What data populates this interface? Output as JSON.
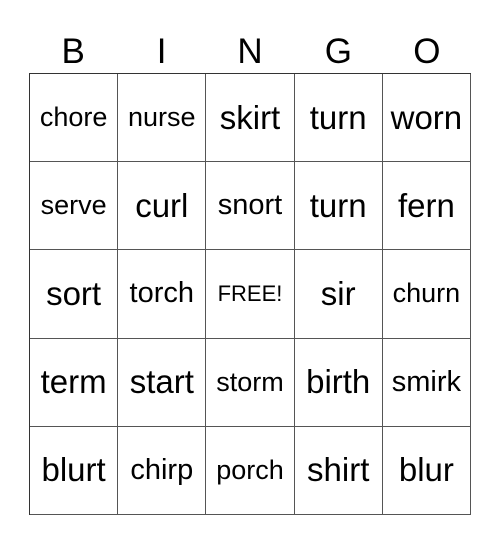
{
  "header": [
    "B",
    "I",
    "N",
    "G",
    "O"
  ],
  "cells": [
    [
      "chore",
      "nurse",
      "skirt",
      "turn",
      "worn"
    ],
    [
      "serve",
      "curl",
      "snort",
      "turn",
      "fern"
    ],
    [
      "sort",
      "torch",
      "FREE!",
      "sir",
      "churn"
    ],
    [
      "term",
      "start",
      "storm",
      "birth",
      "smirk"
    ],
    [
      "blurt",
      "chirp",
      "porch",
      "shirt",
      "blur"
    ]
  ]
}
